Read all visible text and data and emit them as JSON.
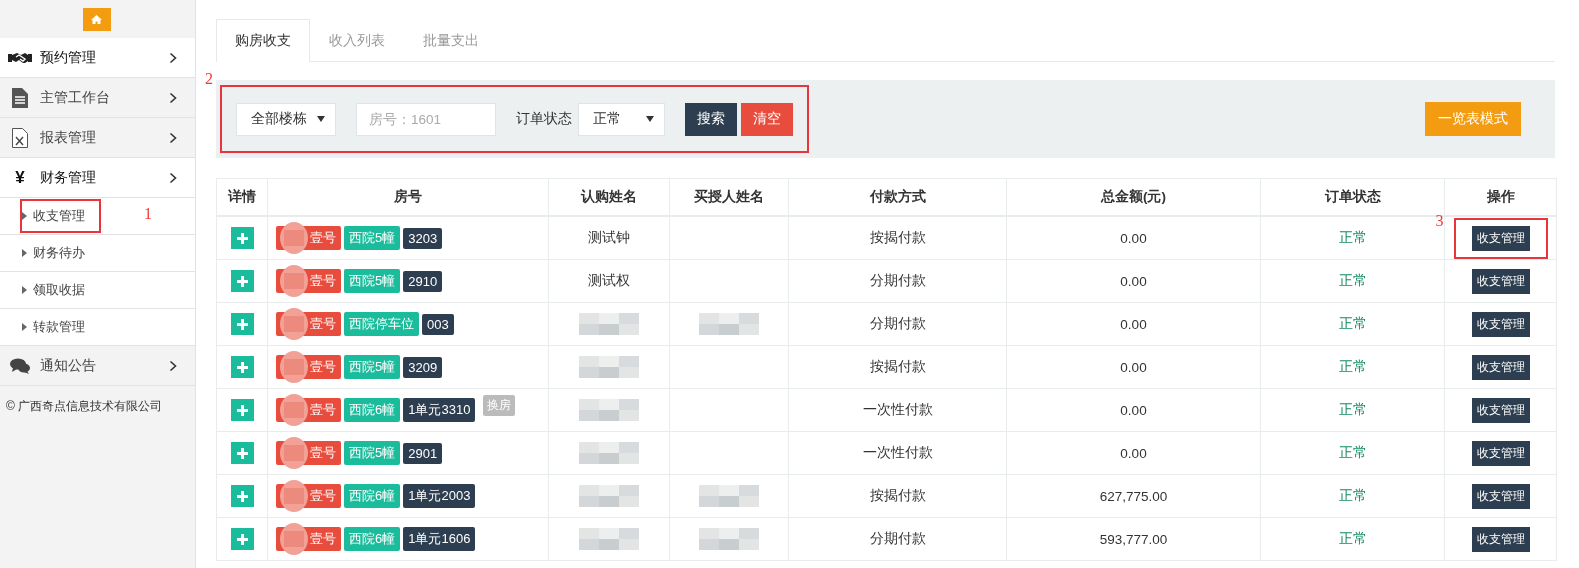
{
  "sidebar": {
    "menu": [
      {
        "label": "预约管理",
        "selected": true
      },
      {
        "label": "主管工作台",
        "selected": false
      },
      {
        "label": "报表管理",
        "selected": false
      },
      {
        "label": "财务管理",
        "glyph": "¥",
        "selected": true,
        "children": [
          {
            "label": "收支管理",
            "annotation": "1"
          },
          {
            "label": "财务待办"
          },
          {
            "label": "领取收据"
          },
          {
            "label": "转款管理"
          }
        ]
      },
      {
        "label": "通知公告",
        "selected": false
      }
    ],
    "copyright": "© 广西奇点信息技术有限公司"
  },
  "tabs": [
    {
      "label": "购房收支",
      "selected": true
    },
    {
      "label": "收入列表",
      "selected": false
    },
    {
      "label": "批量支出",
      "selected": false
    }
  ],
  "filter": {
    "annotation": "2",
    "building": "全部楼栋",
    "room_placeholder": "房号：1601",
    "status_label": "订单状态",
    "status": "正常",
    "search": "搜索",
    "clear": "清空",
    "list_mode": "一览表模式"
  },
  "table": {
    "columns": [
      "详情",
      "房号",
      "认购姓名",
      "买授人姓名",
      "付款方式",
      "总金额(元)",
      "订单状态",
      "操作"
    ],
    "rows": [
      {
        "tag": "壹号",
        "area": "西院5幢",
        "unit": "3203",
        "subscriber": "测试钟",
        "subscriber_redacted": false,
        "grantee_redacted": false,
        "payment": "按揭付款",
        "amount": "0.00",
        "status": "正常",
        "action": "收支管理",
        "annotation": "3"
      },
      {
        "tag": "壹号",
        "area": "西院5幢",
        "unit": "2910",
        "subscriber": "测试权",
        "subscriber_redacted": false,
        "grantee_redacted": false,
        "payment": "分期付款",
        "amount": "0.00",
        "status": "正常",
        "action": "收支管理"
      },
      {
        "tag": "壹号",
        "area": "西院停车位",
        "unit": "003",
        "subscriber_redacted": true,
        "grantee_redacted": true,
        "payment": "分期付款",
        "amount": "0.00",
        "status": "正常",
        "action": "收支管理"
      },
      {
        "tag": "壹号",
        "area": "西院5幢",
        "unit": "3209",
        "subscriber_redacted": true,
        "grantee_redacted": false,
        "payment": "按揭付款",
        "amount": "0.00",
        "status": "正常",
        "action": "收支管理"
      },
      {
        "tag": "壹号",
        "area": "西院6幢",
        "unit": "1单元3310",
        "note": "换房",
        "subscriber_redacted": true,
        "grantee_redacted": false,
        "payment": "一次性付款",
        "amount": "0.00",
        "status": "正常",
        "action": "收支管理"
      },
      {
        "tag": "壹号",
        "area": "西院5幢",
        "unit": "2901",
        "subscriber_redacted": true,
        "grantee_redacted": false,
        "payment": "一次性付款",
        "amount": "0.00",
        "status": "正常",
        "action": "收支管理"
      },
      {
        "tag": "壹号",
        "area": "西院6幢",
        "unit": "1单元2003",
        "subscriber_redacted": true,
        "grantee_redacted": true,
        "payment": "按揭付款",
        "amount": "627,775.00",
        "status": "正常",
        "action": "收支管理"
      },
      {
        "tag": "壹号",
        "area": "西院6幢",
        "unit": "1单元1606",
        "subscriber_redacted": true,
        "grantee_redacted": true,
        "payment": "分期付款",
        "amount": "593,777.00",
        "status": "正常",
        "action": "收支管理"
      }
    ]
  }
}
